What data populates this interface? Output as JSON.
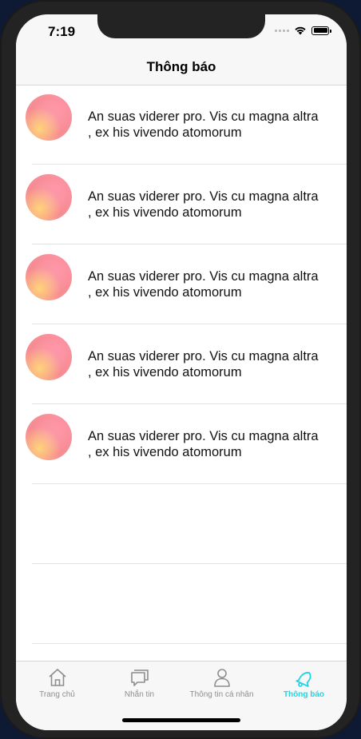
{
  "status_bar": {
    "time": "7:19"
  },
  "header": {
    "title": "Thông báo"
  },
  "notifications": [
    {
      "text": "An suas viderer pro. Vis cu magna altra , ex his vivendo atomorum"
    },
    {
      "text": "An suas viderer pro. Vis cu magna altra , ex his vivendo atomorum"
    },
    {
      "text": "An suas viderer pro. Vis cu magna altra , ex his vivendo atomorum"
    },
    {
      "text": "An suas viderer pro. Vis cu magna altra , ex his vivendo atomorum"
    },
    {
      "text": "An suas viderer pro. Vis cu magna altra , ex his vivendo atomorum"
    }
  ],
  "tabs": [
    {
      "label": "Trang chủ",
      "icon": "home-icon"
    },
    {
      "label": "Nhắn tin",
      "icon": "chat-icon"
    },
    {
      "label": "Thông tin cá nhân",
      "icon": "person-icon"
    },
    {
      "label": "Thông báo",
      "icon": "bell-icon",
      "active": true
    }
  ],
  "colors": {
    "accent": "#1fd6e6",
    "tab_inactive": "#8e8e8e"
  }
}
